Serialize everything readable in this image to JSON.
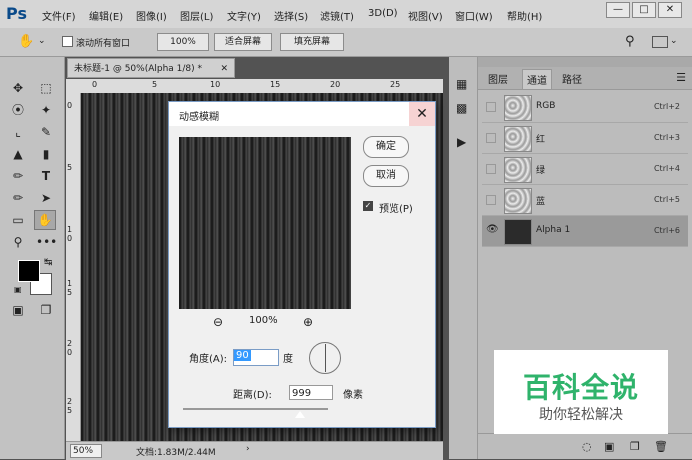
{
  "app": {
    "logo": "Ps"
  },
  "menu": [
    "文件(F)",
    "编辑(E)",
    "图像(I)",
    "图层(L)",
    "文字(Y)",
    "选择(S)",
    "滤镜(T)",
    "3D(D)",
    "视图(V)",
    "窗口(W)",
    "帮助(H)"
  ],
  "options": {
    "scroll_all_label": "滚动所有窗口",
    "zoom_100": "100%",
    "fit_screen": "适合屏幕",
    "fill_screen": "填充屏幕"
  },
  "document": {
    "tab_title": "未标题-1 @ 50%(Alpha 1/8) *",
    "ruler_h": [
      "0",
      "5",
      "10",
      "15",
      "20",
      "25"
    ],
    "ruler_v": [
      "0",
      "5",
      "1 0",
      "1 5",
      "2 0",
      "2 5"
    ],
    "zoom": "50%",
    "doc_info": "文档:1.83M/2.44M"
  },
  "panel": {
    "tabs": [
      "图层",
      "通道",
      "路径"
    ],
    "active_tab": "通道",
    "channels": [
      {
        "name": "RGB",
        "shortcut": "Ctrl+2"
      },
      {
        "name": "红",
        "shortcut": "Ctrl+3"
      },
      {
        "name": "绿",
        "shortcut": "Ctrl+4"
      },
      {
        "name": "蓝",
        "shortcut": "Ctrl+5"
      },
      {
        "name": "Alpha 1",
        "shortcut": "Ctrl+6"
      }
    ]
  },
  "dialog": {
    "title": "动感模糊",
    "ok": "确定",
    "cancel": "取消",
    "preview_label": "预览(P)",
    "preview_checked": true,
    "zoom_level": "100%",
    "angle_label": "角度(A):",
    "angle_value": "90",
    "angle_unit": "度",
    "distance_label": "距离(D):",
    "distance_value": "999",
    "distance_unit": "像素",
    "distance_slider_fraction": 0.81
  },
  "watermark": {
    "title": "百科全说",
    "subtitle": "助你轻松解决"
  }
}
